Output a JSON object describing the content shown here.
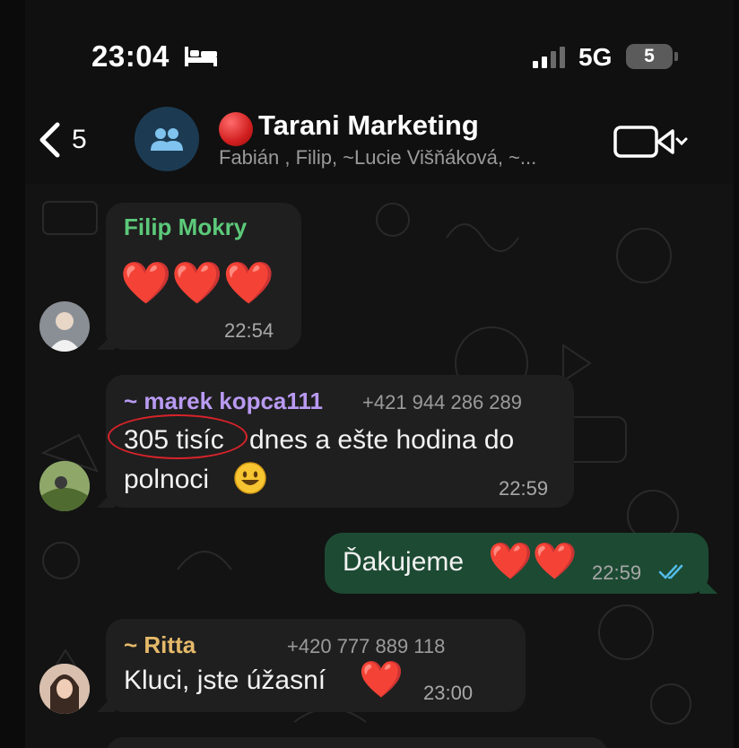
{
  "status_bar": {
    "time": "23:04",
    "network": "5G",
    "battery": "5"
  },
  "header": {
    "back_count": "5",
    "title": "Tarani Marketing",
    "members": "Fabián , Filip, ~Lucie Višňáková, ~..."
  },
  "messages": [
    {
      "sender": "Filip Mokry",
      "text": "",
      "emoji": "❤️❤️❤️",
      "time": "22:54",
      "sender_color": "#5cc97a"
    },
    {
      "sender": "~ marek kopca111",
      "phone": "+421 944 286 289",
      "text_line1_highlight": "305 tisíc",
      "text_line1_rest": "dnes a ešte hodina do",
      "text_line2": "polnoci",
      "time": "22:59",
      "sender_color": "#b99af2"
    },
    {
      "text": "Ďakujeme",
      "time": "22:59",
      "outgoing": true
    },
    {
      "sender": "~ Ritta",
      "phone": "+420 777 889 118",
      "text": "Kluci, jste úžasní",
      "time": "23:00",
      "sender_color": "#e5b96a"
    }
  ],
  "colors": {
    "outgoing_bubble": "#1d4a33",
    "incoming_bubble": "#1f1f1f",
    "read_ticks": "#53bdeb"
  }
}
